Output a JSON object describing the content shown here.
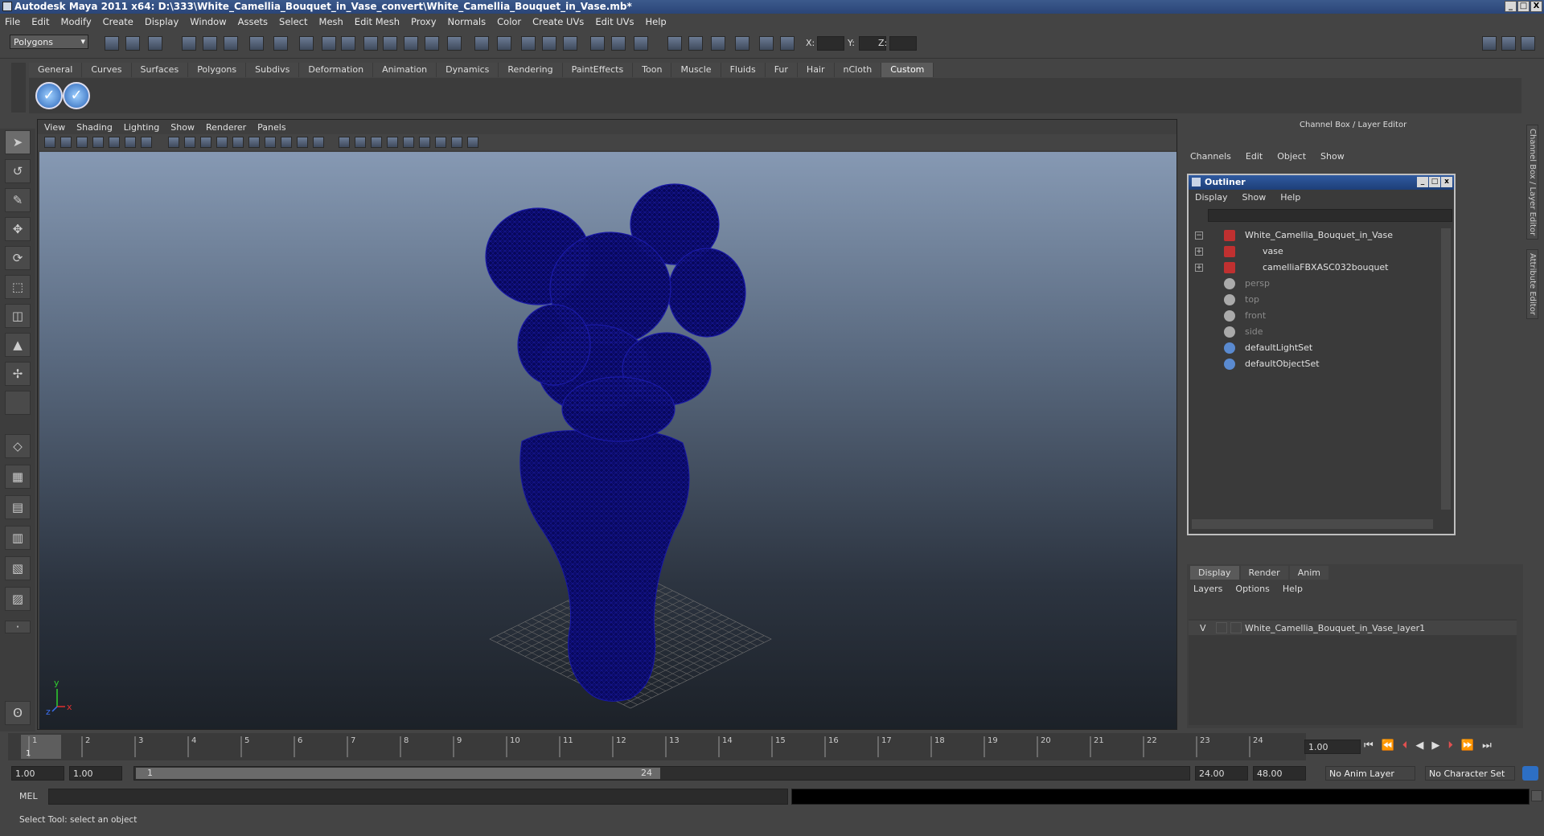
{
  "window": {
    "title": "Autodesk Maya 2011 x64: D:\\333\\White_Camellia_Bouquet_in_Vase_convert\\White_Camellia_Bouquet_in_Vase.mb*",
    "controls": [
      "_",
      "□",
      "X"
    ]
  },
  "menubar": [
    "File",
    "Edit",
    "Modify",
    "Create",
    "Display",
    "Window",
    "Assets",
    "Select",
    "Mesh",
    "Edit Mesh",
    "Proxy",
    "Normals",
    "Color",
    "Create UVs",
    "Edit UVs",
    "Help"
  ],
  "statusline": {
    "mode": "Polygons",
    "x_label": "X:",
    "y_label": "Y:",
    "z_label": "Z:"
  },
  "shelf": {
    "tabs": [
      "General",
      "Curves",
      "Surfaces",
      "Polygons",
      "Subdivs",
      "Deformation",
      "Animation",
      "Dynamics",
      "Rendering",
      "PaintEffects",
      "Toon",
      "Muscle",
      "Fluids",
      "Fur",
      "Hair",
      "nCloth",
      "Custom"
    ],
    "active_tab": "Custom"
  },
  "viewport": {
    "menu": [
      "View",
      "Shading",
      "Lighting",
      "Show",
      "Renderer",
      "Panels"
    ],
    "axis_y": "y",
    "axis_x": "x",
    "axis_z": "z",
    "wire_color": "#0a0a6e"
  },
  "channel_box": {
    "title": "Channel Box / Layer Editor",
    "menu": [
      "Channels",
      "Edit",
      "Object",
      "Show"
    ]
  },
  "outliner": {
    "title": "Outliner",
    "menu": [
      "Display",
      "Show",
      "Help"
    ],
    "items": [
      {
        "label": "White_Camellia_Bouquet_in_Vase",
        "dim": false
      },
      {
        "label": "vase",
        "dim": false
      },
      {
        "label": "camelliaFBXASC032bouquet",
        "dim": false
      },
      {
        "label": "persp",
        "dim": true
      },
      {
        "label": "top",
        "dim": true
      },
      {
        "label": "front",
        "dim": true
      },
      {
        "label": "side",
        "dim": true
      },
      {
        "label": "defaultLightSet",
        "dim": false
      },
      {
        "label": "defaultObjectSet",
        "dim": false
      }
    ]
  },
  "layer_editor": {
    "tabs": [
      "Display",
      "Render",
      "Anim"
    ],
    "menu": [
      "Layers",
      "Options",
      "Help"
    ],
    "layer_visibility": "V",
    "layer_name": "White_Camellia_Bouquet_in_Vase_layer1"
  },
  "side_tabs": [
    "Channel Box / Layer Editor",
    "Attribute Editor"
  ],
  "timeslider": {
    "ticks": [
      "1",
      "2",
      "3",
      "4",
      "5",
      "6",
      "7",
      "8",
      "9",
      "10",
      "11",
      "12",
      "13",
      "14",
      "15",
      "16",
      "17",
      "18",
      "19",
      "20",
      "21",
      "22",
      "23",
      "24"
    ],
    "current_frame": "1",
    "current_time": "1.00"
  },
  "range": {
    "start": "1.00",
    "playback_start": "1.00",
    "slider_start": "1",
    "slider_end": "24",
    "playback_end": "24.00",
    "end": "48.00",
    "anim_layer": "No Anim Layer",
    "character_set": "No Character Set"
  },
  "cmdline": {
    "label": "MEL"
  },
  "helpline": {
    "text": "Select Tool: select an object"
  }
}
